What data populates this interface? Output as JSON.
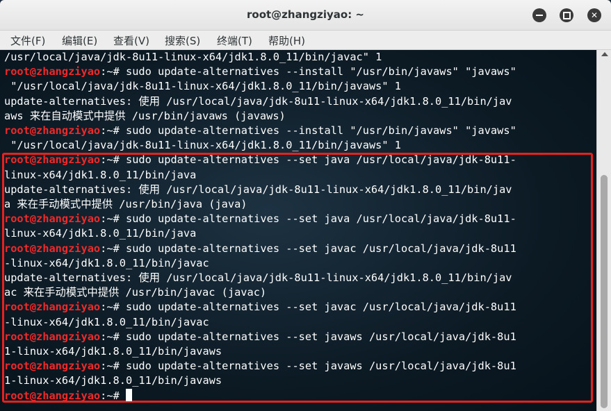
{
  "window": {
    "title": "root@zhangziyao: ~"
  },
  "menubar": {
    "items": [
      "文件(F)",
      "编辑(E)",
      "查看(V)",
      "搜索(S)",
      "终端(T)",
      "帮助(H)"
    ]
  },
  "terminal": {
    "prompt": "root@zhangziyao",
    "lines": [
      {
        "prompt": "",
        "text": "/usr/local/java/jdk-8u11-linux-x64/jdk1.8.0_11/bin/javac\" 1"
      },
      {
        "prompt": "root@zhangziyao",
        "text": ":~# sudo update-alternatives --install \"/usr/bin/javaws\" \"javaws\""
      },
      {
        "prompt": "",
        "text": " \"/usr/local/java/jdk-8u11-linux-x64/jdk1.8.0_11/bin/javaws\" 1"
      },
      {
        "prompt": "",
        "text": "update-alternatives: 使用 /usr/local/java/jdk-8u11-linux-x64/jdk1.8.0_11/bin/jav"
      },
      {
        "prompt": "",
        "text": "aws 来在自动模式中提供 /usr/bin/javaws (javaws)"
      },
      {
        "prompt": "root@zhangziyao",
        "text": ":~# sudo update-alternatives --install \"/usr/bin/javaws\" \"javaws\""
      },
      {
        "prompt": "",
        "text": " \"/usr/local/java/jdk-8u11-linux-x64/jdk1.8.0_11/bin/javaws\" 1"
      },
      {
        "prompt": "root@zhangziyao",
        "text": ":~# sudo update-alternatives --set java /usr/local/java/jdk-8u11-"
      },
      {
        "prompt": "",
        "text": "linux-x64/jdk1.8.0_11/bin/java"
      },
      {
        "prompt": "",
        "text": "update-alternatives: 使用 /usr/local/java/jdk-8u11-linux-x64/jdk1.8.0_11/bin/jav"
      },
      {
        "prompt": "",
        "text": "a 来在手动模式中提供 /usr/bin/java (java)"
      },
      {
        "prompt": "root@zhangziyao",
        "text": ":~# sudo update-alternatives --set java /usr/local/java/jdk-8u11-"
      },
      {
        "prompt": "",
        "text": "linux-x64/jdk1.8.0_11/bin/java"
      },
      {
        "prompt": "root@zhangziyao",
        "text": ":~# sudo update-alternatives --set javac /usr/local/java/jdk-8u11"
      },
      {
        "prompt": "",
        "text": "-linux-x64/jdk1.8.0_11/bin/javac"
      },
      {
        "prompt": "",
        "text": "update-alternatives: 使用 /usr/local/java/jdk-8u11-linux-x64/jdk1.8.0_11/bin/jav"
      },
      {
        "prompt": "",
        "text": "ac 来在手动模式中提供 /usr/bin/javac (javac)"
      },
      {
        "prompt": "root@zhangziyao",
        "text": ":~# sudo update-alternatives --set javac /usr/local/java/jdk-8u11"
      },
      {
        "prompt": "",
        "text": "-linux-x64/jdk1.8.0_11/bin/javac"
      },
      {
        "prompt": "root@zhangziyao",
        "text": ":~# sudo update-alternatives --set javaws /usr/local/java/jdk-8u1"
      },
      {
        "prompt": "",
        "text": "1-linux-x64/jdk1.8.0_11/bin/javaws"
      },
      {
        "prompt": "root@zhangziyao",
        "text": ":~# sudo update-alternatives --set javaws /usr/local/java/jdk-8u1"
      },
      {
        "prompt": "",
        "text": "1-linux-x64/jdk1.8.0_11/bin/javaws"
      },
      {
        "prompt": "root@zhangziyao",
        "text": ":~# "
      }
    ]
  },
  "colors": {
    "prompt": "#ef2929",
    "highlight_border": "#e8211f",
    "terminal_text": "#ffffff"
  },
  "icons": [
    "minimize-icon",
    "maximize-icon",
    "close-icon"
  ]
}
